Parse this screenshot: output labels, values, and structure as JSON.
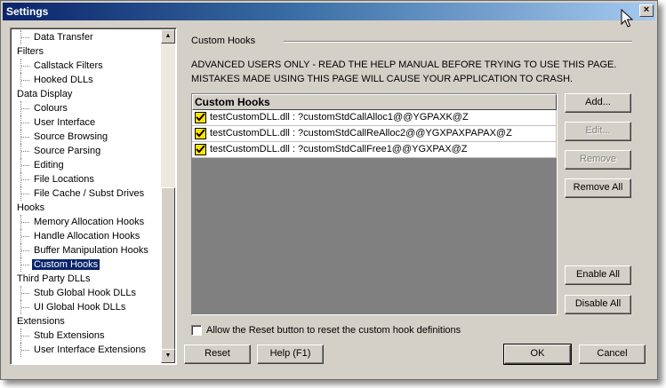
{
  "window": {
    "title": "Settings",
    "close_glyph": "×"
  },
  "tree": {
    "items": [
      {
        "label": "Data Transfer",
        "level": "child"
      },
      {
        "label": "Filters",
        "level": "cat"
      },
      {
        "label": "Callstack Filters",
        "level": "child"
      },
      {
        "label": "Hooked DLLs",
        "level": "child"
      },
      {
        "label": "Data Display",
        "level": "cat"
      },
      {
        "label": "Colours",
        "level": "child"
      },
      {
        "label": "User Interface",
        "level": "child"
      },
      {
        "label": "Source Browsing",
        "level": "child"
      },
      {
        "label": "Source Parsing",
        "level": "child"
      },
      {
        "label": "Editing",
        "level": "child"
      },
      {
        "label": "File Locations",
        "level": "child"
      },
      {
        "label": "File Cache / Subst Drives",
        "level": "child"
      },
      {
        "label": "Hooks",
        "level": "cat"
      },
      {
        "label": "Memory Allocation Hooks",
        "level": "child"
      },
      {
        "label": "Handle Allocation Hooks",
        "level": "child"
      },
      {
        "label": "Buffer Manipulation Hooks",
        "level": "child"
      },
      {
        "label": "Custom Hooks",
        "level": "child",
        "selected": true
      },
      {
        "label": "Third Party DLLs",
        "level": "cat"
      },
      {
        "label": "Stub Global Hook DLLs",
        "level": "child"
      },
      {
        "label": "UI Global Hook DLLs",
        "level": "child"
      },
      {
        "label": "Extensions",
        "level": "cat"
      },
      {
        "label": "Stub Extensions",
        "level": "child"
      },
      {
        "label": "User Interface Extensions",
        "level": "child"
      }
    ]
  },
  "group": {
    "title": "Custom Hooks",
    "warning_line1": "ADVANCED USERS ONLY - READ THE HELP MANUAL BEFORE TRYING TO USE THIS PAGE.",
    "warning_line2": "MISTAKES MADE USING THIS PAGE WILL CAUSE YOUR APPLICATION TO CRASH."
  },
  "hooks_list": {
    "header": "Custom Hooks",
    "rows": [
      {
        "text": "testCustomDLL.dll : ?customStdCallAlloc1@@YGPAXK@Z",
        "checked": true
      },
      {
        "text": "testCustomDLL.dll : ?customStdCallReAlloc2@@YGXPAXPAPAX@Z",
        "checked": true
      },
      {
        "text": "testCustomDLL.dll : ?customStdCallFree1@@YGXPAX@Z",
        "checked": true
      }
    ]
  },
  "buttons": {
    "add": "Add...",
    "edit": "Edit...",
    "remove": "Remove",
    "remove_all": "Remove All",
    "enable_all": "Enable All",
    "disable_all": "Disable All",
    "reset": "Reset",
    "help": "Help (F1)",
    "ok": "OK",
    "cancel": "Cancel"
  },
  "reset_option": {
    "label": "Allow the Reset button to reset the custom hook definitions",
    "checked": false
  },
  "colors": {
    "titlebar_start": "#0a246a",
    "titlebar_end": "#a6caf0",
    "selection": "#0a246a",
    "checkbox_fill": "#ffe400",
    "face": "#d4d0c8"
  }
}
